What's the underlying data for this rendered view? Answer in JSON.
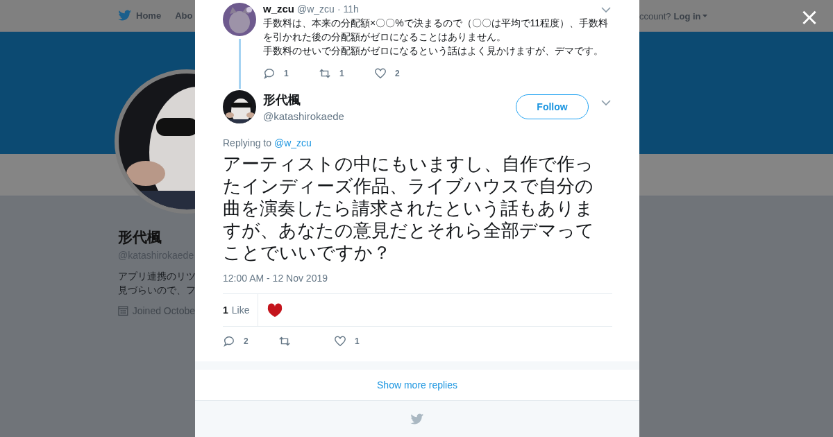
{
  "nav": {
    "items": [
      "Home",
      "Abo"
    ],
    "login_prompt": "ccount?",
    "login": "Log in"
  },
  "profile": {
    "name": "形代楓",
    "handle": "@katashirokaede",
    "bio": [
      "アプリ連携のリツ",
      "見づらいので、フ"
    ],
    "joined": "Joined Octobe"
  },
  "modal": {
    "close": "×",
    "parent_tweet": {
      "name": "w_zcu",
      "handle": "@w_zcu",
      "time": "· 11h",
      "paragraphs": [
        "手数料は、本来の分配額×〇〇%で決まるので（〇〇は平均で11程度）、手数料を引かれた後の分配額がゼロになることはありません。",
        "手数料のせいで分配額がゼロになるという話はよく見かけますが、デマです。"
      ],
      "replies": "1",
      "retweets": "1",
      "likes": "2"
    },
    "tweet": {
      "name": "形代楓",
      "handle": "@katashirokaede",
      "follow": "Follow",
      "replying_label": "Replying to",
      "replying_to": "@w_zcu",
      "text": "アーティストの中にもいますし、自作で作ったインディーズ作品、ライブハウスで自分の曲を演奏したら請求されたという話もありますが、あなたの意見だとそれら全部デマってことでいいですか？",
      "timestamp": "12:00 AM - 12 Nov 2019",
      "like_count": "1",
      "like_label": "Like",
      "replies": "2",
      "likes": "1"
    },
    "show_more": "Show more replies"
  }
}
